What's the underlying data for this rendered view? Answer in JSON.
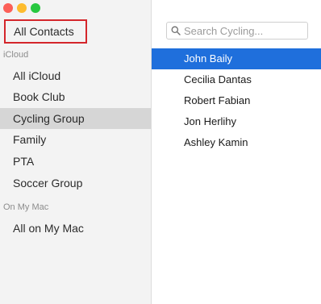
{
  "sidebar": {
    "all_contacts": "All Contacts",
    "icloud_header": "iCloud",
    "icloud_items": [
      "All iCloud",
      "Book Club",
      "Cycling Group",
      "Family",
      "PTA",
      "Soccer Group"
    ],
    "selected_item": "Cycling Group",
    "mac_header": "On My Mac",
    "mac_items": [
      "All on My Mac"
    ]
  },
  "search": {
    "placeholder": "Search Cycling...",
    "icon": "magnifier-icon"
  },
  "contacts": [
    "John Baily",
    "Cecilia Dantas",
    "Robert Fabian",
    "Jon Herlihy",
    "Ashley Kamin"
  ],
  "selected_contact": "John Baily",
  "colors": {
    "selection_blue": "#1f6fdc",
    "sidebar_selected": "#d6d6d6",
    "highlight_border": "#d4262b"
  }
}
